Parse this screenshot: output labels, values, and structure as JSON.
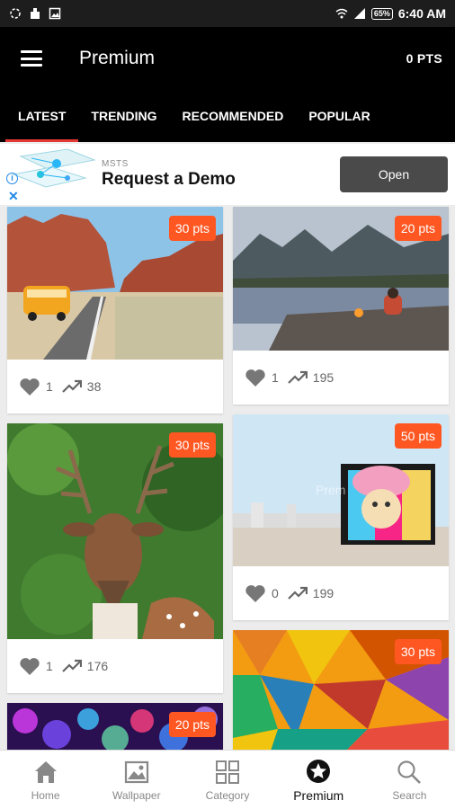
{
  "status": {
    "battery": "65%",
    "time": "6:40 AM",
    "left_icons": [
      "sync-icon",
      "notification-icon",
      "image-icon"
    ],
    "right_icons": [
      "wifi-icon",
      "signal-icon",
      "battery-icon"
    ]
  },
  "app_bar": {
    "title": "Premium",
    "points": "0 PTS",
    "menu_icon": "menu-icon"
  },
  "tabs": [
    "LATEST",
    "TRENDING",
    "RECOMMENDED",
    "POPULAR"
  ],
  "ad": {
    "brand": "MSTS",
    "headline": "Request a Demo",
    "button": "Open"
  },
  "cards": [
    {
      "points": "30 pts",
      "likes": "1",
      "views": "38",
      "subject": "van-desert-canyon-photo"
    },
    {
      "points": "20 pts",
      "likes": "1",
      "views": "195",
      "subject": "mountain-lake-campfire-photo"
    },
    {
      "points": "30 pts",
      "likes": "1",
      "views": "176",
      "subject": "deer-photo"
    },
    {
      "points": "50 pts",
      "likes": "0",
      "views": "199",
      "subject": "street-art-wall-photo",
      "watermark": "Prem"
    },
    {
      "points": "20 pts",
      "subject": "bokeh-lights-photo"
    },
    {
      "points": "30 pts",
      "subject": "colorful-mosaic-photo"
    }
  ],
  "bottom_nav": [
    {
      "label": "Home",
      "icon": "home-icon"
    },
    {
      "label": "Wallpaper",
      "icon": "wallpaper-icon"
    },
    {
      "label": "Category",
      "icon": "category-icon"
    },
    {
      "label": "Premium",
      "icon": "star-badge-icon",
      "active": true
    },
    {
      "label": "Search",
      "icon": "search-icon"
    }
  ],
  "colors": {
    "accent": "#ff5722",
    "tab_indicator": "#e53935",
    "app_bar": "#000000",
    "status_bar": "#1d1d1d"
  }
}
